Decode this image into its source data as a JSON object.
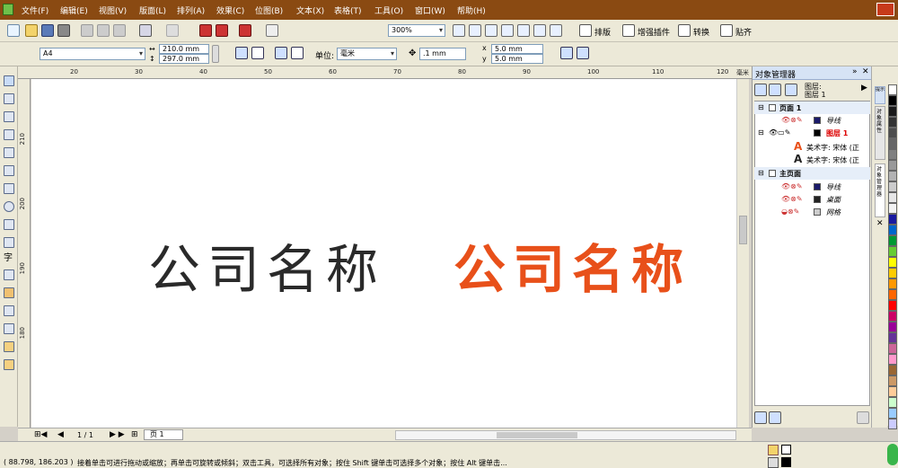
{
  "menu": [
    "文件(F)",
    "编辑(E)",
    "视图(V)",
    "版面(L)",
    "排列(A)",
    "效果(C)",
    "位图(B)",
    "文本(X)",
    "表格(T)",
    "工具(O)",
    "窗口(W)",
    "帮助(H)"
  ],
  "toolbar1": {
    "zoom": "300%",
    "plugins": [
      "排版",
      "增强插件",
      "转换",
      "贴齐"
    ]
  },
  "toolbar2": {
    "page_size": "A4",
    "width": "210.0 mm",
    "height": "297.0 mm",
    "unit_label": "单位:",
    "unit": "毫米",
    "nudge": ".1 mm",
    "dup_x": "5.0 mm",
    "dup_y": "5.0 mm"
  },
  "ruler": {
    "unit": "毫米",
    "h_ticks": [
      "20",
      "30",
      "40",
      "50",
      "60",
      "70",
      "80",
      "90",
      "100",
      "110",
      "120"
    ],
    "v_ticks": [
      "210",
      "200",
      "190",
      "180"
    ]
  },
  "canvas": {
    "text_black": "公司名称",
    "text_orange": "公司名称",
    "black_color": "#2a2a2a",
    "orange_color": "#e8501a"
  },
  "page_nav": {
    "counter": "1 / 1",
    "tab": "页 1"
  },
  "status": {
    "coords": "( 88.798, 186.203 )",
    "hint": "接着单击可进行拖动或缩放；再单击可旋转或倾斜；双击工具，可选择所有对象；按住 Shift 键单击可选择多个对象；按住 Alt 键单击..."
  },
  "object_manager": {
    "title": "对象管理器",
    "layer_header": "图层:",
    "layer_current": "图层 1",
    "page1": "页面 1",
    "guides": "导线",
    "layer1": "图层 1",
    "art1": "美术字: 宋体 (正",
    "art2": "美术字: 宋体 (正",
    "master": "主页面",
    "m_guides": "导线",
    "m_desktop": "桌面",
    "m_grid": "网格"
  },
  "side_tabs": [
    "提示",
    "对象属性",
    "对象管理器"
  ],
  "palette_colors": [
    "#ffffff",
    "#000000",
    "#1a1a1a",
    "#333333",
    "#4d4d4d",
    "#666666",
    "#808080",
    "#999999",
    "#b3b3b3",
    "#cccccc",
    "#e6e6e6",
    "#f2f2f2",
    "#1a1aa0",
    "#0066cc",
    "#009933",
    "#66cc33",
    "#ffff00",
    "#ffcc00",
    "#ff9900",
    "#ff6600",
    "#ff0000",
    "#cc0066",
    "#990099",
    "#663399",
    "#cc6699",
    "#ff99cc",
    "#996633",
    "#cc9966",
    "#ffcc99",
    "#ccffcc",
    "#99ccff",
    "#ccccff"
  ]
}
